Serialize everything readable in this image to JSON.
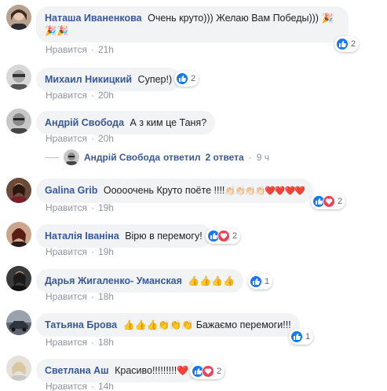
{
  "common": {
    "like_label": "Нравится",
    "separator": "·"
  },
  "comments": [
    {
      "author": "Наташа Иваненкова",
      "text": "Очень круто))) Желаю Вам Победы)))",
      "emoji_tail": "🎉",
      "emoji_line2": "🎉🎉",
      "time": "21h",
      "reaction_count": "2"
    },
    {
      "author": "Михаил Никицкий",
      "text": "Супер!)",
      "time": "20h",
      "reaction_count": "2"
    },
    {
      "author": "Андрій Свобода",
      "text": "А з ким це Таня?",
      "time": "20h"
    },
    {
      "author": "Galina Grib",
      "text": "Ооооочень Круто поёте !!!!",
      "emoji_tail": "👏🏻👏🏻👏🏻👏🏻❤️❤️❤️❤️",
      "time": "19h",
      "reaction_count": "2"
    },
    {
      "author": "Наталія Іваніна",
      "text": "Вірю в перемогу!",
      "time": "19h",
      "reaction_count": "2"
    },
    {
      "author": "Дарья Жигаленко- Уманская",
      "text": "",
      "emoji_tail": "👍👍👍👍",
      "time": "18h",
      "reaction_count": "1"
    },
    {
      "author": "Татьяна Брова",
      "text": "Бажаємо перемоги!!!",
      "emoji_tail": "👍👍👍👏👏👏",
      "time": "18h",
      "reaction_count": "1"
    },
    {
      "author": "Светлана Аш",
      "text": "Красиво!!!!!!!!!",
      "emoji_tail": "❤️",
      "time": "14h",
      "reaction_count": "2"
    }
  ],
  "reply_summary": {
    "author": "Андрій Свобода",
    "action": "ответил",
    "count": "2 ответа",
    "time": "9 ч"
  },
  "colors": {
    "link": "#385898",
    "bubble": "#f2f3f5",
    "meta": "#8d949e",
    "like": "#1877f2",
    "love": "#f33e58"
  }
}
